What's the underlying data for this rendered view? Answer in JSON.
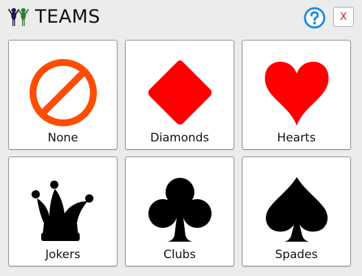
{
  "header": {
    "title": "TEAMS",
    "icon": "team-people-icon",
    "help_icon": "question-circle-icon",
    "close_label": "X"
  },
  "teams": [
    {
      "label": "None",
      "icon": "prohibited-icon",
      "color": "#ff4d00"
    },
    {
      "label": "Diamonds",
      "icon": "diamond-icon",
      "color": "#ff0000"
    },
    {
      "label": "Hearts",
      "icon": "heart-icon",
      "color": "#ff0000"
    },
    {
      "label": "Jokers",
      "icon": "jester-hat-icon",
      "color": "#000000"
    },
    {
      "label": "Clubs",
      "icon": "club-icon",
      "color": "#000000"
    },
    {
      "label": "Spades",
      "icon": "spade-icon",
      "color": "#000000"
    }
  ],
  "colors": {
    "help_blue": "#1e88e5",
    "close_red": "#d42020",
    "team_icon_dark": "#1a1a4a",
    "team_icon_green": "#2e7d32"
  }
}
